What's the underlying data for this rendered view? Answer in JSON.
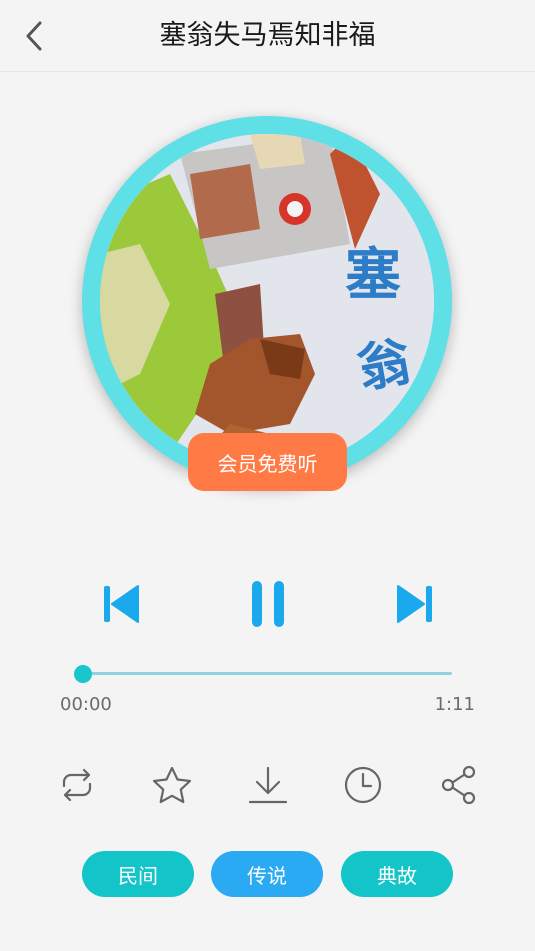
{
  "header": {
    "title": "塞翁失马焉知非福"
  },
  "cover": {
    "vip_label": "会员免费听"
  },
  "player": {
    "current_time": "00:00",
    "total_time": "1:11",
    "progress": 0.0
  },
  "actions": [
    "repeat-icon",
    "star-icon",
    "download-icon",
    "clock-icon",
    "share-icon"
  ],
  "tags": [
    {
      "label": "民间",
      "color": "#13c4c9"
    },
    {
      "label": "传说",
      "color": "#2aaaf2"
    },
    {
      "label": "典故",
      "color": "#13c4c9"
    }
  ],
  "colors": {
    "accent": "#19c6cc",
    "control_blue": "#19a9ec",
    "vip_orange": "#ff7a45"
  }
}
